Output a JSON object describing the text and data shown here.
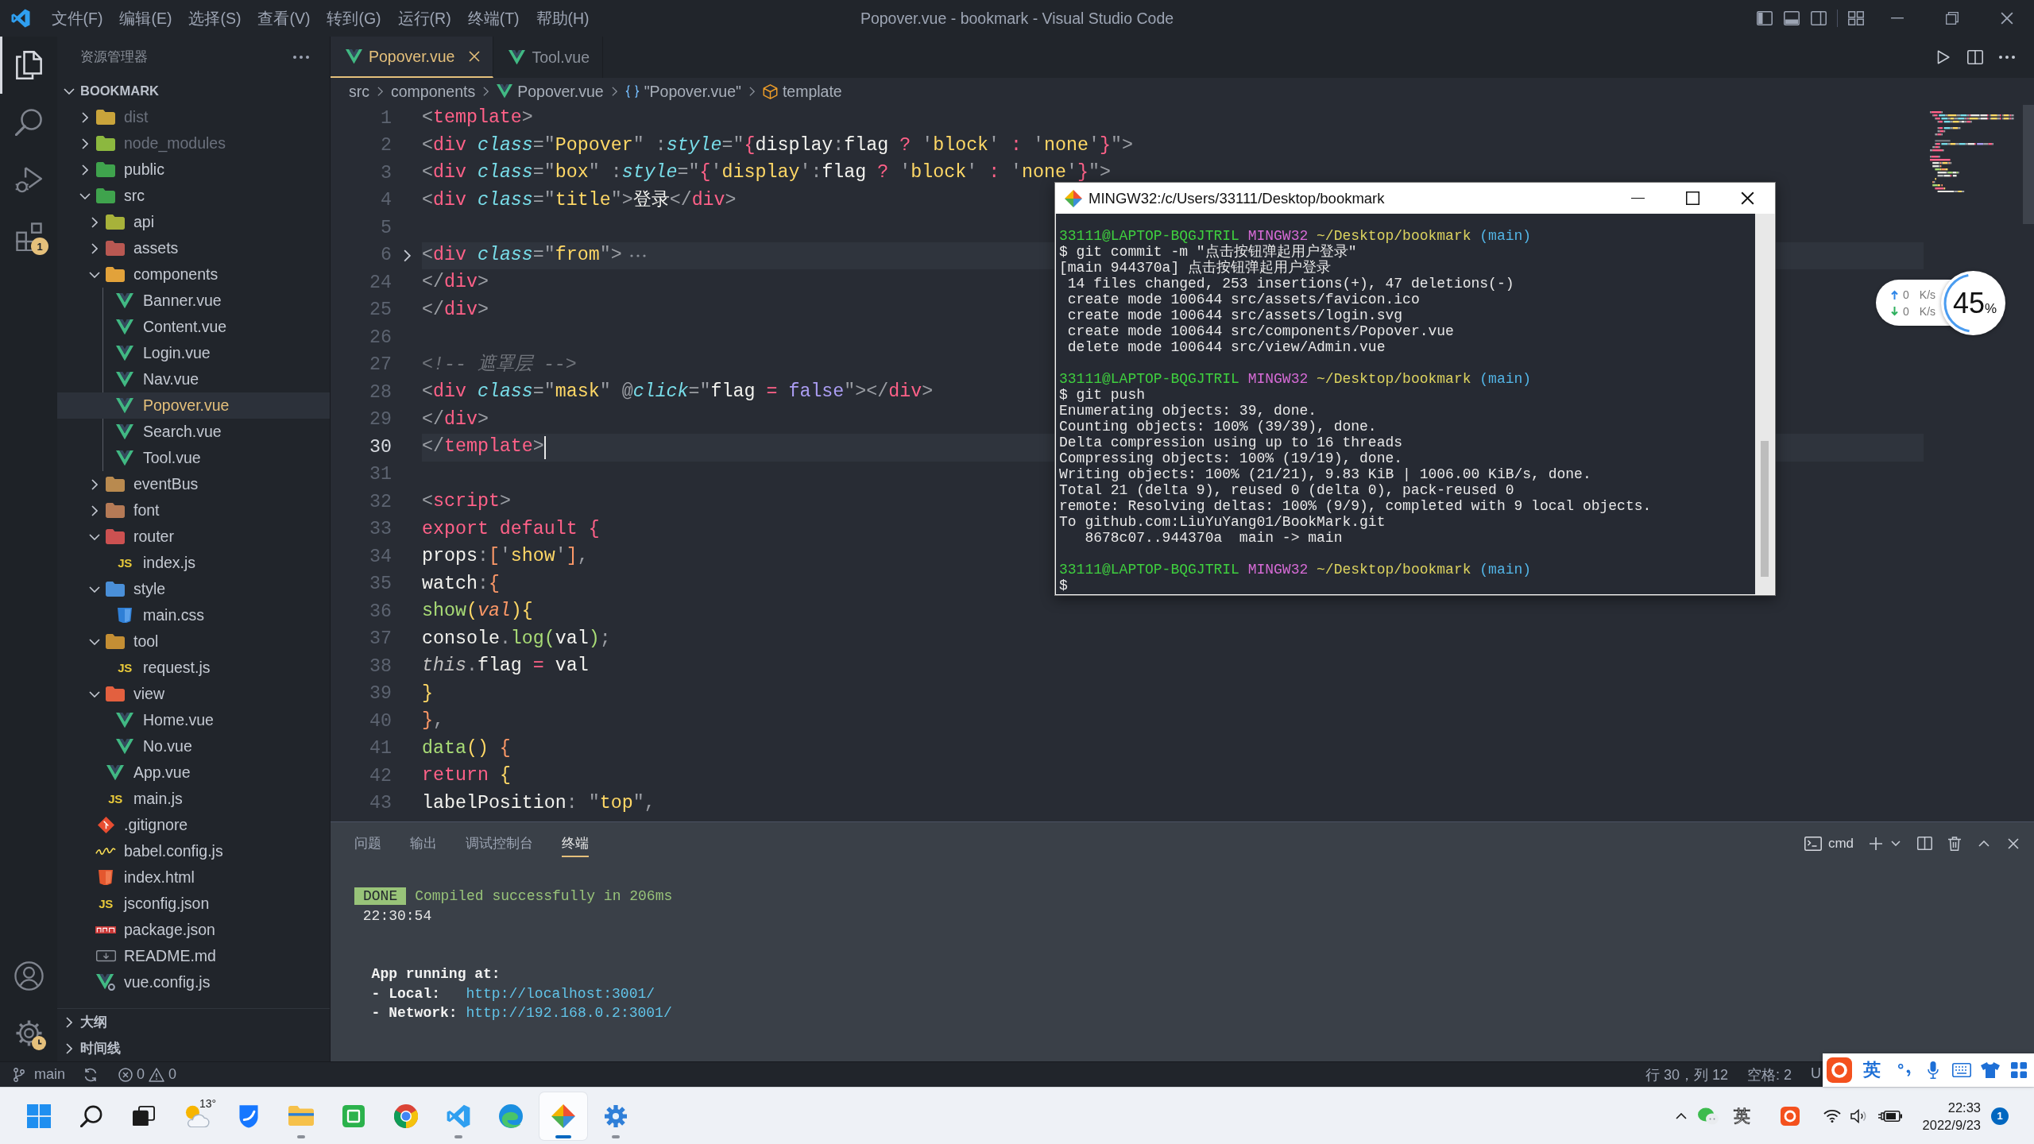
{
  "title_bar": {
    "menu": [
      "文件(F)",
      "编辑(E)",
      "选择(S)",
      "查看(V)",
      "转到(G)",
      "运行(R)",
      "终端(T)",
      "帮助(H)"
    ],
    "title": "Popover.vue - bookmark - Visual Studio Code"
  },
  "activity_bar": {
    "items": [
      {
        "kind": "explorer",
        "selected": true
      },
      {
        "kind": "search",
        "selected": false
      },
      {
        "kind": "debug",
        "selected": false
      },
      {
        "kind": "extensions",
        "selected": false,
        "badge": "1"
      }
    ],
    "bottom": [
      {
        "kind": "account"
      },
      {
        "kind": "manage"
      }
    ]
  },
  "sidebar": {
    "title": "资源管理器",
    "root": {
      "label": "BOOKMARK",
      "expanded": true
    },
    "tree": [
      {
        "label": "dist",
        "kind": "folder",
        "color": "#c9a43b",
        "expanded": false,
        "selected": false,
        "dimmed": true
      },
      {
        "label": "node_modules",
        "kind": "folder",
        "color": "#8cb83f",
        "expanded": false,
        "selected": false,
        "dimmed": true
      },
      {
        "label": "public",
        "kind": "folder",
        "color": "#3fa34d",
        "expanded": false,
        "selected": false,
        "dimmed": false
      },
      {
        "label": "src",
        "kind": "folder",
        "color": "#3fa34d",
        "expanded": true,
        "selected": false,
        "dimmed": false,
        "children": [
          {
            "label": "api",
            "kind": "folder",
            "color": "#a7b23a",
            "expanded": false,
            "selected": false,
            "dimmed": false
          },
          {
            "label": "assets",
            "kind": "folder",
            "color": "#b95852",
            "expanded": false,
            "selected": false,
            "dimmed": false
          },
          {
            "label": "components",
            "kind": "folder",
            "color": "#e2a23a",
            "expanded": true,
            "selected": false,
            "dimmed": false,
            "children": [
              {
                "label": "Banner.vue",
                "kind": "vue",
                "selected": false,
                "dimmed": false
              },
              {
                "label": "Content.vue",
                "kind": "vue",
                "selected": false,
                "dimmed": false
              },
              {
                "label": "Login.vue",
                "kind": "vue",
                "selected": false,
                "dimmed": false
              },
              {
                "label": "Nav.vue",
                "kind": "vue",
                "selected": false,
                "dimmed": false
              },
              {
                "label": "Popover.vue",
                "kind": "vue",
                "selected": true,
                "dimmed": false
              },
              {
                "label": "Search.vue",
                "kind": "vue",
                "selected": false,
                "dimmed": false
              },
              {
                "label": "Tool.vue",
                "kind": "vue",
                "selected": false,
                "dimmed": false
              }
            ]
          },
          {
            "label": "eventBus",
            "kind": "folder",
            "color": "#b98a4f",
            "expanded": false,
            "selected": false,
            "dimmed": false
          },
          {
            "label": "font",
            "kind": "folder",
            "color": "#b57a56",
            "expanded": false,
            "selected": false,
            "dimmed": false
          },
          {
            "label": "router",
            "kind": "folder",
            "color": "#cc5151",
            "expanded": true,
            "selected": false,
            "dimmed": false,
            "children": [
              {
                "label": "index.js",
                "kind": "js",
                "glyph": "JS",
                "selected": false,
                "dimmed": false
              }
            ]
          },
          {
            "label": "style",
            "kind": "folder",
            "color": "#4a8fd8",
            "expanded": true,
            "selected": false,
            "dimmed": false,
            "children": [
              {
                "label": "main.css",
                "kind": "css",
                "selected": false,
                "dimmed": false
              }
            ]
          },
          {
            "label": "tool",
            "kind": "folder",
            "color": "#c48e34",
            "expanded": true,
            "selected": false,
            "dimmed": false,
            "children": [
              {
                "label": "request.js",
                "kind": "js",
                "glyph": "JS",
                "selected": false,
                "dimmed": false
              }
            ]
          },
          {
            "label": "view",
            "kind": "folder",
            "color": "#e3603f",
            "expanded": true,
            "selected": false,
            "dimmed": false,
            "children": [
              {
                "label": "Home.vue",
                "kind": "vue",
                "selected": false,
                "dimmed": false
              },
              {
                "label": "No.vue",
                "kind": "vue",
                "selected": false,
                "dimmed": false
              }
            ]
          },
          {
            "label": "App.vue",
            "kind": "vue",
            "selected": false,
            "dimmed": false
          },
          {
            "label": "main.js",
            "kind": "js",
            "glyph": "JS",
            "selected": false,
            "dimmed": false
          }
        ]
      },
      {
        "label": ".gitignore",
        "kind": "git",
        "selected": false,
        "dimmed": false
      },
      {
        "label": "babel.config.js",
        "kind": "babel",
        "selected": false,
        "dimmed": false
      },
      {
        "label": "index.html",
        "kind": "html",
        "selected": false,
        "dimmed": false
      },
      {
        "label": "jsconfig.json",
        "kind": "js",
        "glyph": "JS",
        "selected": false,
        "dimmed": false
      },
      {
        "label": "package.json",
        "kind": "npm",
        "selected": false,
        "dimmed": false
      },
      {
        "label": "README.md",
        "kind": "markdown",
        "selected": false,
        "dimmed": false
      },
      {
        "label": "vue.config.js",
        "kind": "vue-config",
        "selected": false,
        "dimmed": false
      }
    ],
    "sections": [
      {
        "label": "大纲",
        "expanded": false
      },
      {
        "label": "时间线",
        "expanded": false
      }
    ]
  },
  "tabs": [
    {
      "label": "Popover.vue",
      "kind": "vue",
      "selected": true
    },
    {
      "label": "Tool.vue",
      "kind": "vue",
      "selected": false
    }
  ],
  "breadcrumb": [
    {
      "label": "src",
      "kind": "folder"
    },
    {
      "label": "components",
      "kind": "folder"
    },
    {
      "label": "Popover.vue",
      "kind": "vue"
    },
    {
      "label": "\"Popover.vue\"",
      "kind": "object"
    },
    {
      "label": "template",
      "kind": "element"
    }
  ],
  "editor": {
    "lines": [
      {
        "number": "1",
        "current": false,
        "folded": false,
        "tokens": [
          {
            "kind": "punct",
            "text": "<"
          },
          {
            "kind": "tag",
            "text": "template"
          },
          {
            "kind": "punct",
            "text": ">"
          }
        ]
      },
      {
        "number": "2",
        "current": false,
        "folded": false,
        "tokens": [
          {
            "kind": "punct",
            "text": "  <"
          },
          {
            "kind": "tag",
            "text": "div"
          },
          {
            "kind": "attr",
            "text": " class"
          },
          {
            "kind": "punct",
            "text": "=\""
          },
          {
            "kind": "string",
            "text": "Popover"
          },
          {
            "kind": "punct",
            "text": "\" :"
          },
          {
            "kind": "attr",
            "text": "style"
          },
          {
            "kind": "punct",
            "text": "=\""
          },
          {
            "kind": "bracket1",
            "text": "{"
          },
          {
            "kind": "plain",
            "text": "display"
          },
          {
            "kind": "punct",
            "text": ":"
          },
          {
            "kind": "plain",
            "text": "flag "
          },
          {
            "kind": "operator",
            "text": "?"
          },
          {
            "kind": "punct",
            "text": " '"
          },
          {
            "kind": "string",
            "text": "block"
          },
          {
            "kind": "punct",
            "text": "' "
          },
          {
            "kind": "operator",
            "text": ":"
          },
          {
            "kind": "punct",
            "text": " '"
          },
          {
            "kind": "string",
            "text": "none"
          },
          {
            "kind": "punct",
            "text": "'"
          },
          {
            "kind": "bracket1",
            "text": "}"
          },
          {
            "kind": "punct",
            "text": "\">"
          }
        ]
      },
      {
        "number": "3",
        "current": false,
        "folded": false,
        "tokens": [
          {
            "kind": "punct",
            "text": "    <"
          },
          {
            "kind": "tag",
            "text": "div"
          },
          {
            "kind": "attr",
            "text": " class"
          },
          {
            "kind": "punct",
            "text": "=\""
          },
          {
            "kind": "string",
            "text": "box"
          },
          {
            "kind": "punct",
            "text": "\" :"
          },
          {
            "kind": "attr",
            "text": "style"
          },
          {
            "kind": "punct",
            "text": "=\""
          },
          {
            "kind": "bracket1",
            "text": "{"
          },
          {
            "kind": "punct",
            "text": "'"
          },
          {
            "kind": "string",
            "text": "display"
          },
          {
            "kind": "punct",
            "text": "':"
          },
          {
            "kind": "plain",
            "text": "flag "
          },
          {
            "kind": "operator",
            "text": "?"
          },
          {
            "kind": "punct",
            "text": " '"
          },
          {
            "kind": "string",
            "text": "block"
          },
          {
            "kind": "punct",
            "text": "' "
          },
          {
            "kind": "operator",
            "text": ":"
          },
          {
            "kind": "punct",
            "text": " '"
          },
          {
            "kind": "string",
            "text": "none"
          },
          {
            "kind": "punct",
            "text": "'"
          },
          {
            "kind": "bracket1",
            "text": "}"
          },
          {
            "kind": "punct",
            "text": "\">"
          }
        ]
      },
      {
        "number": "4",
        "current": false,
        "folded": false,
        "tokens": [
          {
            "kind": "punct",
            "text": "      <"
          },
          {
            "kind": "tag",
            "text": "div"
          },
          {
            "kind": "attr",
            "text": " class"
          },
          {
            "kind": "punct",
            "text": "=\""
          },
          {
            "kind": "string",
            "text": "title"
          },
          {
            "kind": "punct",
            "text": "\">"
          },
          {
            "kind": "plain",
            "text": "登录"
          },
          {
            "kind": "punct",
            "text": "</"
          },
          {
            "kind": "tag",
            "text": "div"
          },
          {
            "kind": "punct",
            "text": ">"
          }
        ]
      },
      {
        "number": "5",
        "current": false,
        "folded": false
      },
      {
        "number": "6",
        "current": false,
        "folded": true,
        "tokens": [
          {
            "kind": "punct",
            "text": "      <"
          },
          {
            "kind": "tag",
            "text": "div"
          },
          {
            "kind": "attr",
            "text": " class"
          },
          {
            "kind": "punct",
            "text": "=\""
          },
          {
            "kind": "string",
            "text": "from"
          },
          {
            "kind": "punct",
            "text": "\">"
          }
        ]
      },
      {
        "number": "24",
        "current": false,
        "folded": false,
        "tokens": [
          {
            "kind": "punct",
            "text": "      </"
          },
          {
            "kind": "tag",
            "text": "div"
          },
          {
            "kind": "punct",
            "text": ">"
          }
        ]
      },
      {
        "number": "25",
        "current": false,
        "folded": false,
        "tokens": [
          {
            "kind": "punct",
            "text": "    </"
          },
          {
            "kind": "tag",
            "text": "div"
          },
          {
            "kind": "punct",
            "text": ">"
          }
        ]
      },
      {
        "number": "26",
        "current": false,
        "folded": false
      },
      {
        "number": "27",
        "current": false,
        "folded": false,
        "tokens": [
          {
            "kind": "comment",
            "text": "    <!-- 遮罩层 -->"
          }
        ]
      },
      {
        "number": "28",
        "current": false,
        "folded": false,
        "tokens": [
          {
            "kind": "punct",
            "text": "    <"
          },
          {
            "kind": "tag",
            "text": "div"
          },
          {
            "kind": "attr",
            "text": " class"
          },
          {
            "kind": "punct",
            "text": "=\""
          },
          {
            "kind": "string",
            "text": "mask"
          },
          {
            "kind": "punct",
            "text": "\" @"
          },
          {
            "kind": "attr",
            "text": "click"
          },
          {
            "kind": "punct",
            "text": "=\""
          },
          {
            "kind": "plain",
            "text": "flag "
          },
          {
            "kind": "operator",
            "text": "="
          },
          {
            "kind": "constant",
            "text": " false"
          },
          {
            "kind": "punct",
            "text": "\"></"
          },
          {
            "kind": "tag",
            "text": "div"
          },
          {
            "kind": "punct",
            "text": ">"
          }
        ]
      },
      {
        "number": "29",
        "current": false,
        "folded": false,
        "tokens": [
          {
            "kind": "punct",
            "text": "  </"
          },
          {
            "kind": "tag",
            "text": "div"
          },
          {
            "kind": "punct",
            "text": ">"
          }
        ]
      },
      {
        "number": "30",
        "current": true,
        "folded": false,
        "tokens": [
          {
            "kind": "punct",
            "text": "</"
          },
          {
            "kind": "tag",
            "text": "template"
          },
          {
            "kind": "punct",
            "text": ">"
          }
        ]
      },
      {
        "number": "31",
        "current": false,
        "folded": false
      },
      {
        "number": "32",
        "current": false,
        "folded": false,
        "tokens": [
          {
            "kind": "punct",
            "text": "<"
          },
          {
            "kind": "tag",
            "text": "script"
          },
          {
            "kind": "punct",
            "text": ">"
          }
        ]
      },
      {
        "number": "33",
        "current": false,
        "folded": false,
        "tokens": [
          {
            "kind": "keyword",
            "text": "export default "
          },
          {
            "kind": "bracket1",
            "text": "{"
          }
        ]
      },
      {
        "number": "34",
        "current": false,
        "folded": false,
        "tokens": [
          {
            "kind": "plain",
            "text": "  props"
          },
          {
            "kind": "punct",
            "text": ":"
          },
          {
            "kind": "bracket2",
            "text": "["
          },
          {
            "kind": "punct",
            "text": "'"
          },
          {
            "kind": "string",
            "text": "show"
          },
          {
            "kind": "punct",
            "text": "'"
          },
          {
            "kind": "bracket2",
            "text": "]"
          },
          {
            "kind": "punct",
            "text": ","
          }
        ]
      },
      {
        "number": "35",
        "current": false,
        "folded": false,
        "tokens": [
          {
            "kind": "plain",
            "text": "  watch"
          },
          {
            "kind": "punct",
            "text": ":"
          },
          {
            "kind": "bracket2",
            "text": "{"
          }
        ]
      },
      {
        "number": "36",
        "current": false,
        "folded": false,
        "tokens": [
          {
            "kind": "function",
            "text": "    show"
          },
          {
            "kind": "bracket3",
            "text": "("
          },
          {
            "kind": "param",
            "text": "val"
          },
          {
            "kind": "bracket3",
            "text": "){"
          }
        ]
      },
      {
        "number": "37",
        "current": false,
        "folded": false,
        "tokens": [
          {
            "kind": "plain",
            "text": "      console"
          },
          {
            "kind": "punct",
            "text": "."
          },
          {
            "kind": "function",
            "text": "log"
          },
          {
            "kind": "bracket4",
            "text": "("
          },
          {
            "kind": "plain",
            "text": "val"
          },
          {
            "kind": "bracket4",
            "text": ")"
          },
          {
            "kind": "punct",
            "text": ";"
          }
        ]
      },
      {
        "number": "38",
        "current": false,
        "folded": false,
        "tokens": [
          {
            "kind": "language",
            "text": "      this"
          },
          {
            "kind": "punct",
            "text": "."
          },
          {
            "kind": "plain",
            "text": "flag "
          },
          {
            "kind": "operator",
            "text": "="
          },
          {
            "kind": "plain",
            "text": " val"
          }
        ]
      },
      {
        "number": "39",
        "current": false,
        "folded": false,
        "tokens": [
          {
            "kind": "bracket3",
            "text": "    }"
          }
        ]
      },
      {
        "number": "40",
        "current": false,
        "folded": false,
        "tokens": [
          {
            "kind": "bracket2",
            "text": "  }"
          },
          {
            "kind": "punct",
            "text": ","
          }
        ]
      },
      {
        "number": "41",
        "current": false,
        "folded": false,
        "tokens": [
          {
            "kind": "function",
            "text": "  data"
          },
          {
            "kind": "bracket3",
            "text": "()"
          },
          {
            "kind": "bracket2",
            "text": " {"
          }
        ]
      },
      {
        "number": "42",
        "current": false,
        "folded": false,
        "tokens": [
          {
            "kind": "keyword",
            "text": "    return "
          },
          {
            "kind": "bracket3",
            "text": "{"
          }
        ]
      },
      {
        "number": "43",
        "current": false,
        "folded": false,
        "tokens": [
          {
            "kind": "plain",
            "text": "      labelPosition"
          },
          {
            "kind": "punct",
            "text": ": \""
          },
          {
            "kind": "string",
            "text": "top"
          },
          {
            "kind": "punct",
            "text": "\","
          }
        ]
      }
    ]
  },
  "panel": {
    "tabs": [
      {
        "label": "问题",
        "selected": false
      },
      {
        "label": "输出",
        "selected": false
      },
      {
        "label": "调试控制台",
        "selected": false
      },
      {
        "label": "终端",
        "selected": true
      }
    ],
    "terminal_name": "cmd",
    "output": [
      [
        [
          {
            "kind": "badge",
            "text": "DONE"
          },
          {
            "kind": "success",
            "text": "Compiled successfully in 206ms"
          }
        ],
        [
          {
            "kind": "plain",
            "text": " 22:30:54"
          }
        ]
      ],
      [
        [
          {
            "kind": "bold",
            "text": "  App running at:"
          }
        ],
        [
          {
            "kind": "bold",
            "text": "  - Local:   "
          },
          {
            "kind": "link",
            "text": "http://localhost:3001/"
          }
        ],
        [
          {
            "kind": "bold",
            "text": "  - Network: "
          },
          {
            "kind": "link",
            "text": "http://192.168.0.2:3001/"
          }
        ]
      ]
    ]
  },
  "status_bar": {
    "branch": "main",
    "errors": "0",
    "warnings": "0",
    "position": "行 30，列 12",
    "indentation": "空格: 2",
    "encoding": "U"
  },
  "terminal_window": {
    "title": "MINGW32:/c/Users/33111/Desktop/bookmark",
    "output": [
      [
        {
          "kind": "prompt",
          "user": "33111@LAPTOP-BQGJTRIL",
          "system": "MINGW32",
          "path": "~/Desktop/bookmark",
          "branch": "(main)"
        },
        {
          "kind": "output",
          "text": "$ git commit -m \"点击按钮弹起用户登录\""
        },
        {
          "kind": "output",
          "text": "[main 944370a] 点击按钮弹起用户登录"
        },
        {
          "kind": "output",
          "text": " 14 files changed, 253 insertions(+), 47 deletions(-)"
        },
        {
          "kind": "output",
          "text": " create mode 100644 src/assets/favicon.ico"
        },
        {
          "kind": "output",
          "text": " create mode 100644 src/assets/login.svg"
        },
        {
          "kind": "output",
          "text": " create mode 100644 src/components/Popover.vue"
        },
        {
          "kind": "output",
          "text": " delete mode 100644 src/view/Admin.vue"
        }
      ],
      [
        {
          "kind": "prompt",
          "user": "33111@LAPTOP-BQGJTRIL",
          "system": "MINGW32",
          "path": "~/Desktop/bookmark",
          "branch": "(main)"
        },
        {
          "kind": "output",
          "text": "$ git push"
        },
        {
          "kind": "output",
          "text": "Enumerating objects: 39, done."
        },
        {
          "kind": "output",
          "text": "Counting objects: 100% (39/39), done."
        },
        {
          "kind": "output",
          "text": "Delta compression using up to 16 threads"
        },
        {
          "kind": "output",
          "text": "Compressing objects: 100% (19/19), done."
        },
        {
          "kind": "output",
          "text": "Writing objects: 100% (21/21), 9.83 KiB | 1006.00 KiB/s, done."
        },
        {
          "kind": "output",
          "text": "Total 21 (delta 9), reused 0 (delta 0), pack-reused 0"
        },
        {
          "kind": "output",
          "text": "remote: Resolving deltas: 100% (9/9), completed with 9 local objects."
        },
        {
          "kind": "output",
          "text": "To github.com:LiuYuYang01/BookMark.git"
        },
        {
          "kind": "output",
          "text": "   8678c07..944370a  main -> main"
        }
      ],
      [
        {
          "kind": "prompt",
          "user": "33111@LAPTOP-BQGJTRIL",
          "system": "MINGW32",
          "path": "~/Desktop/bookmark",
          "branch": "(main)"
        },
        {
          "kind": "output",
          "text": "$"
        }
      ]
    ]
  },
  "net_widget": {
    "upload": {
      "value": "0",
      "unit": "K/s"
    },
    "download": {
      "value": "0",
      "unit": "K/s"
    },
    "usage": "45$_{%}$",
    "level": 0.45
  },
  "ime_toolbar": {
    "mode": "英"
  },
  "taskbar": {
    "buttons": [
      {
        "kind": "start",
        "running": false,
        "selected": false
      },
      {
        "kind": "search",
        "running": false,
        "selected": false
      },
      {
        "kind": "task-view",
        "running": false,
        "selected": false
      },
      {
        "kind": "weather",
        "label": "13°",
        "running": false,
        "selected": false
      },
      {
        "kind": "shield-app",
        "running": false,
        "selected": false
      },
      {
        "kind": "explorer",
        "running": true,
        "selected": false
      },
      {
        "kind": "hbuilder",
        "running": false,
        "selected": false
      },
      {
        "kind": "chrome",
        "running": false,
        "selected": false
      },
      {
        "kind": "vscode",
        "running": true,
        "selected": false
      },
      {
        "kind": "edge",
        "running": false,
        "selected": false
      },
      {
        "kind": "git",
        "running": true,
        "selected": true
      },
      {
        "kind": "gear-app",
        "running": true,
        "selected": false
      }
    ],
    "tray": {
      "ime": "英",
      "time": "22:33",
      "date": "2022/9/23",
      "notifications": "1"
    }
  }
}
